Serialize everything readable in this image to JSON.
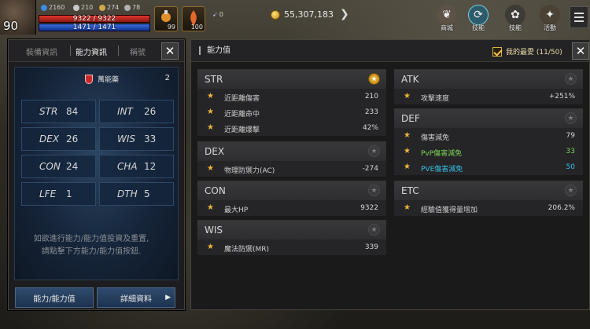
{
  "hud": {
    "level": "90",
    "stat1": "2160",
    "stat2": "210",
    "stat3": "274",
    "stat4": "78",
    "hp": "9322 / 9322",
    "mp": "1471 / 1471",
    "slot1_count": "99",
    "slot2_count": "100",
    "arrow_count": "0",
    "gold": "55,307,183",
    "icons": [
      {
        "name": "wing-icon",
        "label": "商城"
      },
      {
        "name": "dragon-icon",
        "label": "技能"
      },
      {
        "name": "swirl-icon",
        "label": "技能"
      },
      {
        "name": "event-icon",
        "label": "活動"
      }
    ]
  },
  "left_panel": {
    "tabs": [
      "裝備資訊",
      "能力資訊",
      "稱號"
    ],
    "active_tab": 1,
    "potion_label": "萬能藥",
    "potion_count": "2",
    "stats": [
      {
        "name": "STR",
        "value": "84"
      },
      {
        "name": "INT",
        "value": "26"
      },
      {
        "name": "DEX",
        "value": "26"
      },
      {
        "name": "WIS",
        "value": "33"
      },
      {
        "name": "CON",
        "value": "24"
      },
      {
        "name": "CHA",
        "value": "12"
      },
      {
        "name": "LFE",
        "value": "1"
      },
      {
        "name": "DTH",
        "value": "5"
      }
    ],
    "hint_line1": "如欲進行能力/能力值投資及重置,",
    "hint_line2": "請點擊下方能力/能力值按鈕.",
    "btn_stats": "能力/能力值",
    "btn_detail": "詳細資料"
  },
  "right_panel": {
    "title": "能力值",
    "favorites_label": "我的最愛 (11/50)",
    "sections": [
      {
        "name": "STR",
        "starred": true,
        "rows": [
          {
            "label": "近距離傷害",
            "value": "210"
          },
          {
            "label": "近距離命中",
            "value": "233"
          },
          {
            "label": "近距離爆擊",
            "value": "42%"
          }
        ]
      },
      {
        "name": "DEX",
        "starred": false,
        "rows": [
          {
            "label": "物理防禦力(AC)",
            "value": "-274"
          }
        ]
      },
      {
        "name": "CON",
        "starred": false,
        "rows": [
          {
            "label": "最大HP",
            "value": "9322"
          }
        ]
      },
      {
        "name": "WIS",
        "starred": false,
        "rows": [
          {
            "label": "魔法防禦(MR)",
            "value": "339"
          }
        ]
      },
      {
        "name": "ATK",
        "starred": false,
        "rows": [
          {
            "label": "攻擊速度",
            "value": "+251%"
          }
        ]
      },
      {
        "name": "DEF",
        "starred": false,
        "rows": [
          {
            "label": "傷害減免",
            "value": "79"
          },
          {
            "label": "PvP傷害減免",
            "value": "33"
          },
          {
            "label": "PVE傷害減免",
            "value": "50"
          }
        ]
      },
      {
        "name": "ETC",
        "starred": false,
        "rows": [
          {
            "label": "經驗值獲得量增加",
            "value": "206.2%"
          }
        ]
      }
    ]
  },
  "colors": {
    "accent_gold": "#f0b43a",
    "pvp_green": "#7fd55a",
    "pve_cyan": "#38c0e8",
    "hp_red": "#e0342d",
    "mp_blue": "#3a6fe0"
  }
}
